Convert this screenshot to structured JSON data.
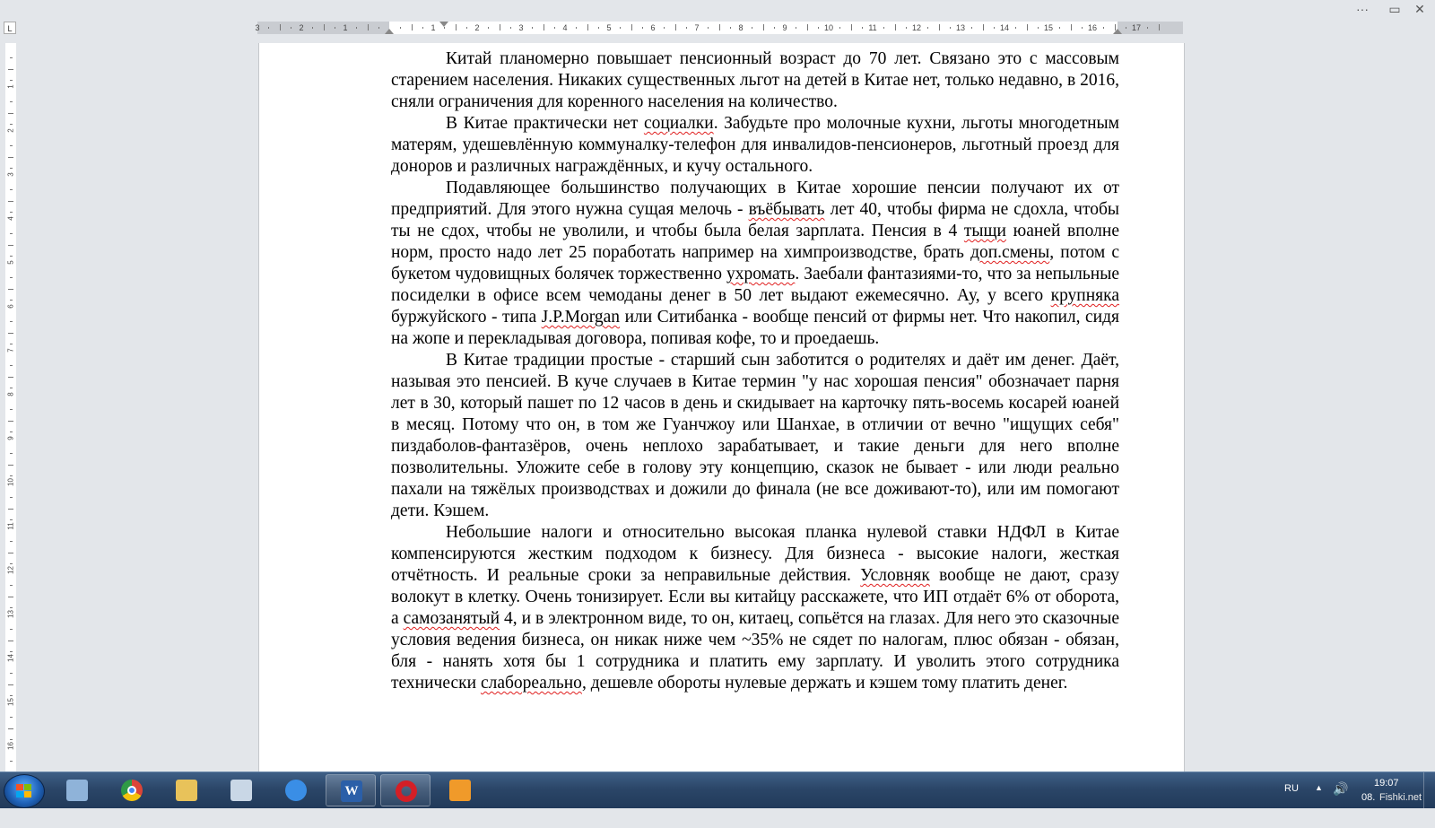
{
  "window": {
    "controls": [
      "···",
      "▭",
      "✕"
    ]
  },
  "ruler": {
    "tab_selector": "L",
    "left_numbers": [
      "3",
      "2",
      "1"
    ],
    "right_numbers": [
      "1",
      "2",
      "3",
      "4",
      "5",
      "6",
      "7",
      "8",
      "9",
      "10",
      "11",
      "12",
      "13",
      "14",
      "15",
      "16",
      "17"
    ],
    "vertical_numbers": [
      "1",
      "2",
      "3",
      "4",
      "5",
      "6",
      "7",
      "8",
      "9",
      "10",
      "11",
      "12",
      "13",
      "14",
      "15",
      "16"
    ]
  },
  "document": {
    "paragraphs": [
      [
        {
          "t": "Китай планомерно повышает пенсионный возраст до 70 лет. Связано это с массовым старением населения. Никаких существенных льгот на детей в Китае нет, только недавно, в 2016, сняли ограничения для коренного населения на количество."
        }
      ],
      [
        {
          "t": "В Китае практически нет "
        },
        {
          "t": "социалки",
          "err": true
        },
        {
          "t": ". Забудьте про молочные кухни, льготы многодетным матерям, удешевлённую коммуналку-телефон для инвалидов-пенсионеров, льготный проезд для доноров и различных награждённых, и кучу остального."
        }
      ],
      [
        {
          "t": "Подавляющее большинство получающих в Китае хорошие пенсии получают их от предприятий. Для этого нужна сущая мелочь - "
        },
        {
          "t": "въёбывать",
          "err": true
        },
        {
          "t": " лет 40, чтобы фирма не сдохла, чтобы ты не сдох, чтобы не уволили, и чтобы была белая зарплата. Пенсия в 4 "
        },
        {
          "t": "тыщи",
          "err": true
        },
        {
          "t": " юаней вполне норм, просто надо лет 25 поработать например на химпроизводстве, брать "
        },
        {
          "t": "доп.смены",
          "err": true
        },
        {
          "t": ", потом с букетом чудовищных болячек торжественно "
        },
        {
          "t": "ухромать",
          "err": true
        },
        {
          "t": ". Заебали фантазиями-то, что за непыльные посиделки в офисе всем чемоданы денег в 50 лет выдают ежемесячно. Ау, у всего "
        },
        {
          "t": "крупняка",
          "err": true
        },
        {
          "t": " буржуйского - типа "
        },
        {
          "t": "J.P.Morgan",
          "err": true
        },
        {
          "t": " или Ситибанка - вообще пенсий от фирмы нет. Что накопил, сидя на жопе и перекладывая договора, попивая кофе, то и проедаешь."
        }
      ],
      [
        {
          "t": "В Китае традиции простые - старший сын заботится о родителях и даёт им денег. Даёт, называя это пенсией. В куче случаев в Китае термин \"у нас хорошая пенсия\" обозначает парня лет в 30, который пашет по 12 часов в день и скидывает на карточку пять-восемь косарей юаней в месяц. Потому что он, в том же Гуанчжоу или Шанхае, в отличии от вечно \"ищущих себя\" пиздаболов-фантазёров, очень неплохо зарабатывает, и такие деньги для него вполне позволительны. Уложите себе в голову эту концепцию, сказок не бывает - или люди реально пахали на тяжёлых производствах и дожили до финала (не все доживают-то), или им помогают дети. Кэшем."
        }
      ],
      [
        {
          "t": "Небольшие налоги и относительно высокая планка нулевой ставки НДФЛ в Китае компенсируются жестким подходом к бизнесу. Для бизнеса - высокие налоги, жесткая отчётность. И реальные сроки за неправильные действия. "
        },
        {
          "t": "Условняк",
          "err": true
        },
        {
          "t": " вообще не дают, сразу волокут в клетку. Очень тонизирует. Если вы китайцу расскажете, что ИП отдаёт 6% от оборота, а "
        },
        {
          "t": "самозанятый",
          "err": true
        },
        {
          "t": " 4, и в электронном виде, то он, китаец, сопьётся на глазах. Для него это сказочные условия ведения бизнеса, он никак ниже чем ~35% не сядет по налогам, плюс обязан - обязан, бля - нанять хотя бы 1 сотрудника и платить ему зарплату. И уволить этого сотрудника технически "
        },
        {
          "t": "слабореально",
          "err": true
        },
        {
          "t": ", дешевле обороты нулевые держать и кэшем тому платить денег."
        }
      ]
    ]
  },
  "taskbar": {
    "items": [
      {
        "name": "calculator-icon",
        "color": "#8fb3d9"
      },
      {
        "name": "chrome-icon",
        "color": "#2f9a46"
      },
      {
        "name": "explorer-icon",
        "color": "#e8c25a"
      },
      {
        "name": "paint-icon",
        "color": "#c9d7e6"
      },
      {
        "name": "internet-explorer-icon",
        "color": "#3a8ee6"
      },
      {
        "name": "word-icon",
        "color": "#2b5fa8",
        "label": "W",
        "active": true
      },
      {
        "name": "opera-icon",
        "color": "#d41f26",
        "active": true
      },
      {
        "name": "media-player-icon",
        "color": "#f09a2a"
      }
    ],
    "tray": {
      "language": "RU",
      "time": "19:07",
      "date": "08.",
      "watermark": "Fishki.net"
    }
  }
}
